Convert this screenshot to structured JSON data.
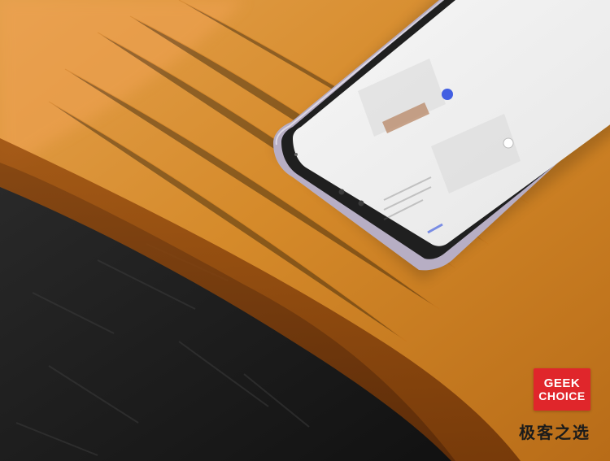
{
  "photo": {
    "subject": "smartphone-on-wooden-table",
    "colors": {
      "wood": "#d58a2a",
      "wood_dark": "#b76614",
      "dark_surface": "#1a1a1a",
      "phone_frame": "#b7aec4",
      "screen": "#f0f0f0"
    }
  },
  "logo": {
    "line1": "GEEK",
    "line2": "CHOICE",
    "color": "#e0262b"
  },
  "caption": {
    "text": "极客之选"
  }
}
